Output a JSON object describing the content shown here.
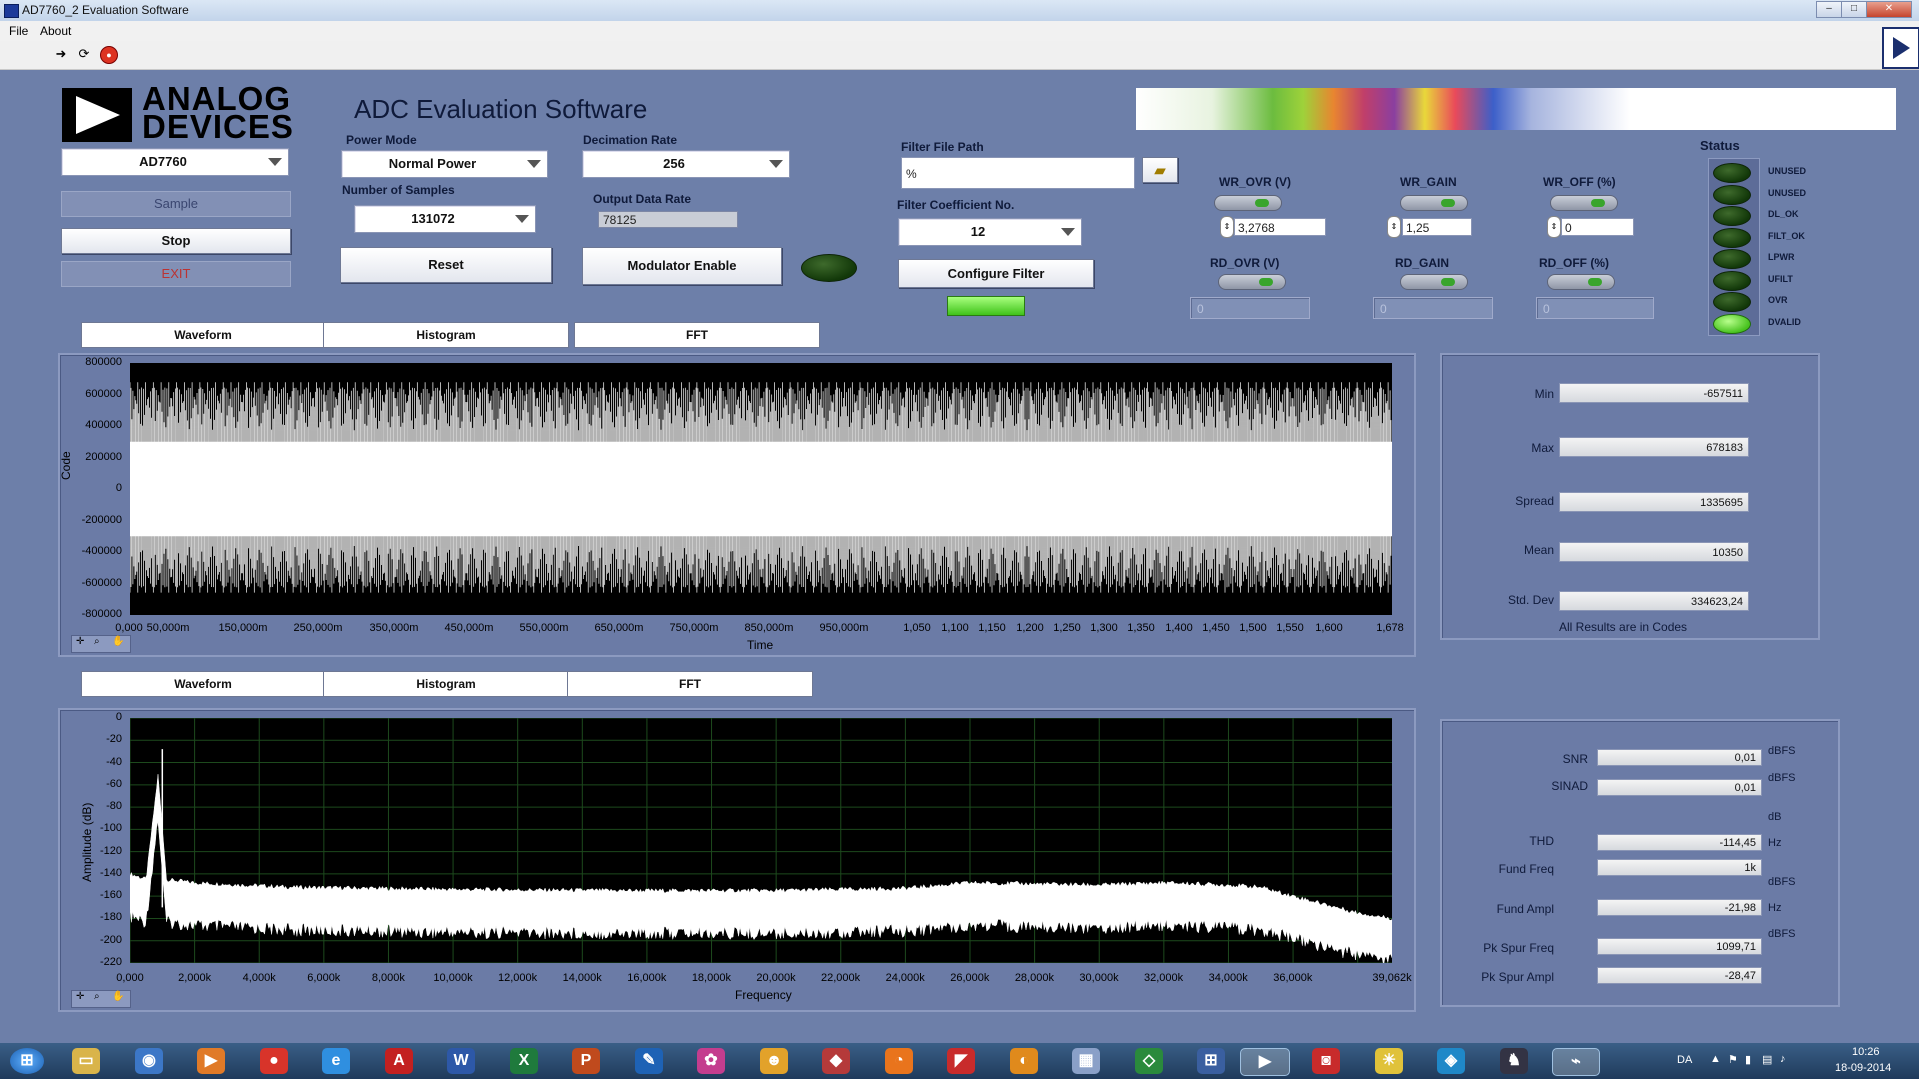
{
  "window": {
    "title": "AD7760_2 Evaluation Software",
    "min": "–",
    "max": "□",
    "close": "✕"
  },
  "menu": {
    "file": "File",
    "about": "About"
  },
  "toolbar": {
    "run_icon": "arrow-right-icon",
    "continuous_icon": "continuous-run-icon",
    "stop_icon": "abort-icon"
  },
  "header": {
    "logo_line1": "ANALOG",
    "logo_line2": "DEVICES",
    "app_title": "ADC Evaluation Software"
  },
  "left": {
    "device": "AD7760",
    "sample_label": "Sample",
    "stop_label": "Stop",
    "exit_label": "EXIT"
  },
  "controls": {
    "power_mode_label": "Power Mode",
    "power_mode_value": "Normal Power",
    "num_samples_label": "Number of Samples",
    "num_samples_value": "131072",
    "reset_label": "Reset",
    "decimation_label": "Decimation Rate",
    "decimation_value": "256",
    "output_rate_label": "Output Data Rate",
    "output_rate_value": "78125",
    "modulator_label": "Modulator Enable",
    "filter_path_label": "Filter File Path",
    "filter_path_value": "%",
    "filter_coef_label": "Filter Coefficient No.",
    "filter_coef_value": "12",
    "configure_label": "Configure Filter"
  },
  "registers": {
    "wr_ovr_label": "WR_OVR (V)",
    "wr_ovr_value": "3,2768",
    "wr_gain_label": "WR_GAIN",
    "wr_gain_value": "1,25",
    "wr_off_label": "WR_OFF (%)",
    "wr_off_value": "0",
    "rd_ovr_label": "RD_OVR (V)",
    "rd_ovr_value": "0",
    "rd_gain_label": "RD_GAIN",
    "rd_gain_value": "0",
    "rd_off_label": "RD_OFF (%)",
    "rd_off_value": "0"
  },
  "status": {
    "title": "Status",
    "items": [
      {
        "label": "UNUSED",
        "on": false
      },
      {
        "label": "UNUSED",
        "on": false
      },
      {
        "label": "DL_OK",
        "on": false
      },
      {
        "label": "FILT_OK",
        "on": false
      },
      {
        "label": "LPWR",
        "on": false
      },
      {
        "label": "UFILT",
        "on": false
      },
      {
        "label": "OVR",
        "on": false
      },
      {
        "label": "DVALID",
        "on": true
      }
    ]
  },
  "tabs_top": [
    "Waveform",
    "Histogram",
    "FFT"
  ],
  "tabs_bottom": [
    "Waveform",
    "Histogram",
    "FFT"
  ],
  "chart_data": [
    {
      "type": "line",
      "xlabel": "Time",
      "ylabel": "Code",
      "ylim": [
        -800000,
        800000
      ],
      "yticks": [
        "800000",
        "600000",
        "400000",
        "200000",
        "0",
        "-200000",
        "-400000",
        "-600000",
        "-800000"
      ],
      "xticks": [
        "0,000",
        "50,000m",
        "150,000m",
        "250,000m",
        "350,000m",
        "450,000m",
        "550,000m",
        "650,000m",
        "750,000m",
        "850,000m",
        "950,000m",
        "1,050",
        "1,100",
        "1,150",
        "1,200",
        "1,250",
        "1,300",
        "1,350",
        "1,400",
        "1,450",
        "1,500",
        "1,550",
        "1,600",
        "1,678"
      ],
      "series": [
        {
          "min": -657511,
          "max": 678183
        }
      ],
      "grid": false,
      "colors": {
        "background": "#000000",
        "trace": "#ffffff"
      }
    },
    {
      "type": "line",
      "xlabel": "Frequency",
      "ylabel": "Amplitude (dB)",
      "ylim": [
        -220,
        0
      ],
      "xlim": [
        0,
        39062
      ],
      "yticks": [
        "0",
        "-20",
        "-40",
        "-60",
        "-80",
        "-100",
        "-120",
        "-140",
        "-160",
        "-180",
        "-200",
        "-220"
      ],
      "xticks": [
        "0,000",
        "2,000k",
        "4,000k",
        "6,000k",
        "8,000k",
        "10,000k",
        "12,000k",
        "14,000k",
        "16,000k",
        "18,000k",
        "20,000k",
        "22,000k",
        "24,000k",
        "26,000k",
        "28,000k",
        "30,000k",
        "32,000k",
        "34,000k",
        "36,000k",
        "39,062k"
      ],
      "series": [
        {
          "x": [
            0,
            500,
            1000,
            1100,
            2000,
            5000,
            10000,
            15000,
            20000,
            24000,
            26000,
            30000,
            32000,
            34000,
            35000,
            36000,
            38000,
            39062
          ],
          "y": [
            -150,
            -155,
            -28,
            -155,
            -158,
            -162,
            -164,
            -165,
            -165,
            -163,
            -158,
            -160,
            -158,
            -160,
            -162,
            -170,
            -185,
            -190
          ]
        }
      ],
      "grid": true,
      "colors": {
        "background": "#000000",
        "grid": "#1d4a1d",
        "trace": "#ffffff"
      }
    }
  ],
  "stats": {
    "min_label": "Min",
    "min_value": "-657511",
    "max_label": "Max",
    "max_value": "678183",
    "spread_label": "Spread",
    "spread_value": "1335695",
    "mean_label": "Mean",
    "mean_value": "10350",
    "std_label": "Std. Dev",
    "std_value": "334623,24",
    "note": "All Results are in Codes"
  },
  "fft_results": {
    "snr_label": "SNR",
    "snr_value": "0,01",
    "snr_unit": "dBFS",
    "sinad_label": "SINAD",
    "sinad_value": "0,01",
    "sinad_unit": "dBFS",
    "db_unit": "dB",
    "thd_label": "THD",
    "thd_value": "-114,45",
    "thd_unit": "Hz",
    "fund_freq_label": "Fund Freq",
    "fund_freq_value": "1k",
    "fund_freq_unit": "dBFS",
    "fund_ampl_label": "Fund Ampl",
    "fund_ampl_value": "-21,98",
    "fund_ampl_unit": "Hz",
    "spur_freq_label": "Pk Spur Freq",
    "spur_freq_value": "1099,71",
    "spur_freq_unit": "dBFS",
    "spur_ampl_label": "Pk Spur Ampl",
    "spur_ampl_value": "-28,47"
  },
  "taskbar": {
    "lang": "DA",
    "time": "10:26",
    "date": "18-09-2014",
    "word_icon": "W",
    "excel_icon": "X",
    "pdf_icon": "A"
  }
}
